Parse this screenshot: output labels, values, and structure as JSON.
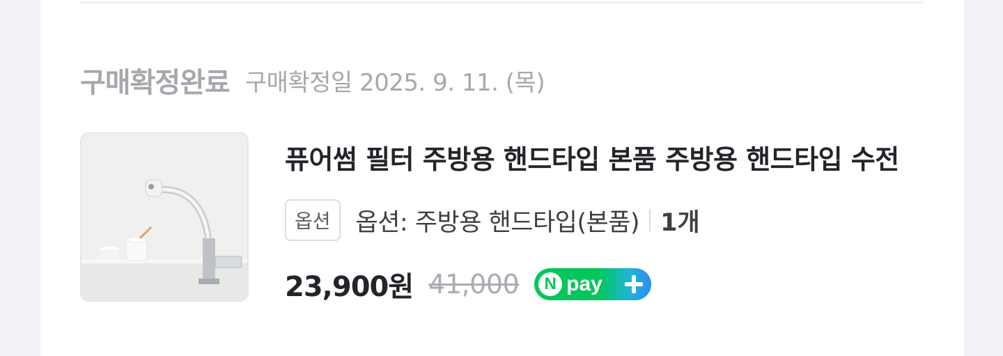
{
  "order": {
    "status_title": "구매확정완료",
    "status_date": "구매확정일 2025. 9. 11. (목)"
  },
  "product": {
    "name": "퓨어썸 필터 주방용 핸드타입 본품 주방용 핸드타입 수전",
    "image_icon": "faucet-product-image",
    "option_badge": "옵션",
    "option_text": "옵션: 주방용 핸드타입(본품)",
    "quantity": "1개",
    "sale_price": "23,900원",
    "original_price": "41,000",
    "payment_badge": {
      "n": "N",
      "label": "pay",
      "icon": "plus-icon"
    }
  },
  "colors": {
    "npay_green": "#03c75a",
    "npay_blue": "#2d8cf0",
    "muted_text": "#a5a8ad"
  }
}
